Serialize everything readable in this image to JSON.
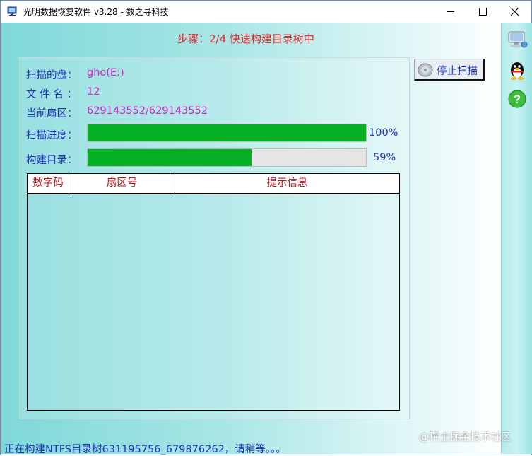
{
  "window": {
    "title": "光明数据恢复软件 v3.28 - 数之寻科技"
  },
  "step_title": "步骤：2/4 快速构建目录树中",
  "info": {
    "disk_label": "扫描的盘：",
    "disk_value": "gho(E:)",
    "files_label": "文 件 名 ：",
    "files_value": "12",
    "sector_label": "当前扇区：",
    "sector_value": "629143552/629143552"
  },
  "progress": {
    "scan_label": "扫描进度：",
    "scan_fraction": 1.0,
    "scan_percent": "100%",
    "build_label": "构建目录：",
    "build_fraction": 0.59,
    "build_percent": "59%",
    "fill_color": "#06b025"
  },
  "table": {
    "columns": [
      "数字码",
      "扇区号",
      "提示信息"
    ],
    "rows": []
  },
  "buttons": {
    "stop_scan": "停止扫描"
  },
  "sidebar": {
    "icons": [
      "computer-icon",
      "qq-penguin-icon",
      "help-icon"
    ]
  },
  "status_bar": {
    "text": "正在构建NTFS目录树631195756_679876262，请稍等。。。"
  },
  "watermark": "@稀土掘金技术社区",
  "colors": {
    "label_blue": "#1f33b8",
    "value_magenta": "#d020c8",
    "title_red": "#e0262a",
    "header_red": "#b8161c"
  }
}
